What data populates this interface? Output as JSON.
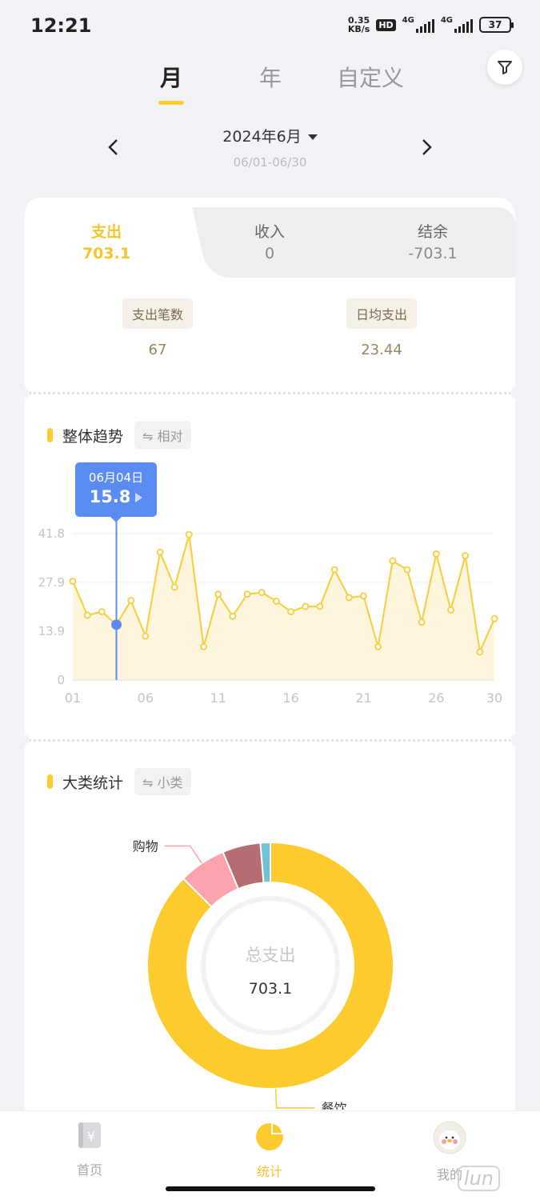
{
  "status_bar": {
    "time": "12:21",
    "net_speed_value": "0.35",
    "net_speed_unit": "KB/s",
    "hd": "HD",
    "net1": "4G",
    "net2": "4G",
    "battery": "37"
  },
  "tabs": [
    {
      "label": "月"
    },
    {
      "label": "年"
    },
    {
      "label": "自定义"
    }
  ],
  "date": {
    "title": "2024年6月",
    "range": "06/01-06/30"
  },
  "summary": [
    {
      "label": "支出",
      "value": "703.1"
    },
    {
      "label": "收入",
      "value": "0"
    },
    {
      "label": "结余",
      "value": "-703.1"
    }
  ],
  "stats": [
    {
      "label": "支出笔数",
      "value": "67"
    },
    {
      "label": "日均支出",
      "value": "23.44"
    }
  ],
  "trend": {
    "title": "整体趋势",
    "toggle": "⇋ 相对",
    "tooltip_date": "06月04日",
    "tooltip_value": "15.8"
  },
  "category": {
    "title": "大类统计",
    "toggle": "⇋ 小类",
    "center_label": "总支出",
    "center_value": "703.1"
  },
  "colors": {
    "accent": "#fdcb2d",
    "line": "#f7d04a",
    "highlight": "#5b8cf2"
  },
  "chart_data": [
    {
      "type": "line",
      "ylim": [
        0,
        41.8
      ],
      "y_ticks": [
        "41.8",
        "27.9",
        "13.9",
        "0"
      ],
      "x_tick_labels": [
        "01",
        "06",
        "11",
        "16",
        "21",
        "26",
        "30"
      ],
      "x": [
        1,
        2,
        3,
        4,
        5,
        6,
        7,
        8,
        9,
        10,
        11,
        12,
        13,
        14,
        15,
        16,
        17,
        18,
        19,
        20,
        21,
        22,
        23,
        24,
        25,
        26,
        27,
        28,
        29,
        30
      ],
      "values": [
        28.2,
        18.5,
        19.5,
        15.8,
        22.7,
        12.5,
        36.5,
        26.5,
        41.5,
        9.5,
        24.5,
        18.2,
        24.5,
        25,
        22.5,
        19.5,
        21,
        21,
        31.5,
        23.5,
        24,
        9.5,
        34,
        31.5,
        16.5,
        36,
        20,
        35.5,
        8,
        17.5
      ],
      "highlight_x": 4
    },
    {
      "type": "pie",
      "labels": [
        "餐饮",
        "购物",
        "",
        ""
      ],
      "values": [
        87.5,
        6.2,
        5.0,
        1.3
      ],
      "colors": [
        "#fdcb2d",
        "#fca4ad",
        "#b56d72",
        "#6ec3d6"
      ]
    }
  ],
  "bottom_nav": [
    {
      "label": "首页",
      "icon": "wallet-icon"
    },
    {
      "label": "统计",
      "icon": "pie-icon"
    },
    {
      "label": "我的",
      "icon": "avatar"
    }
  ],
  "watermark": "lun"
}
